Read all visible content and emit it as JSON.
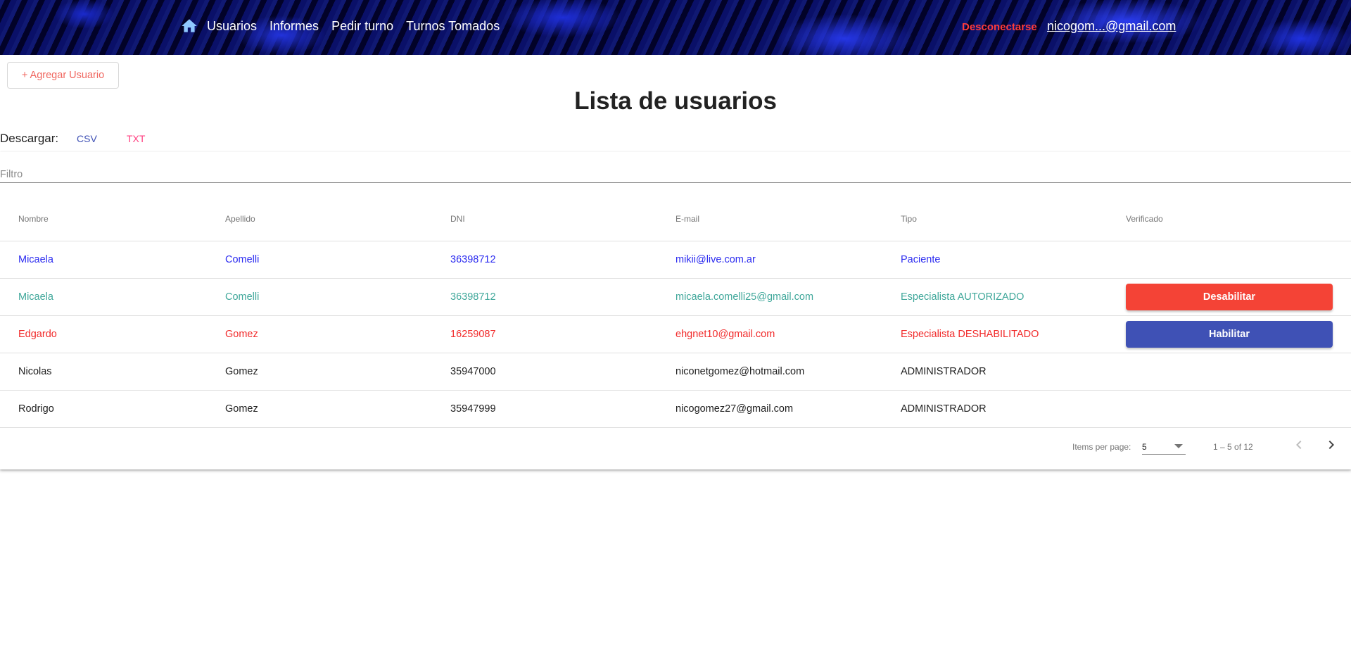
{
  "nav": {
    "items": [
      "Usuarios",
      "Informes",
      "Pedir turno",
      "Turnos Tomados"
    ],
    "logout": "Desconectarse",
    "user_email": "nicogom...@gmail.com"
  },
  "toolbar": {
    "add_user": "+ Agregar Usuario"
  },
  "page": {
    "title": "Lista de usuarios"
  },
  "download": {
    "label": "Descargar:",
    "csv": "CSV",
    "txt": "TXT"
  },
  "filter": {
    "placeholder": "Filtro",
    "value": ""
  },
  "table": {
    "headers": [
      "Nombre",
      "Apellido",
      "DNI",
      "E-mail",
      "Tipo",
      "Verificado"
    ],
    "rows": [
      {
        "nombre": "Micaela",
        "apellido": "Comelli",
        "dni": "36398712",
        "email": "mikii@live.com.ar",
        "tipo": "Paciente",
        "verificado": ""
      },
      {
        "nombre": "Micaela",
        "apellido": "Comelli",
        "dni": "36398712",
        "email": "micaela.comelli25@gmail.com",
        "tipo": "Especialista AUTORIZADO",
        "verificado": "Desabilitar"
      },
      {
        "nombre": "Edgardo",
        "apellido": "Gomez",
        "dni": "16259087",
        "email": "ehgnet10@gmail.com",
        "tipo": "Especialista DESHABILITADO",
        "verificado": "Habilitar"
      },
      {
        "nombre": "Nicolas",
        "apellido": "Gomez",
        "dni": "35947000",
        "email": "niconetgomez@hotmail.com",
        "tipo": "ADMINISTRADOR",
        "verificado": ""
      },
      {
        "nombre": "Rodrigo",
        "apellido": "Gomez",
        "dni": "35947999",
        "email": "nicogomez27@gmail.com",
        "tipo": "ADMINISTRADOR",
        "verificado": ""
      }
    ]
  },
  "paginator": {
    "items_per_page_label": "Items per page:",
    "items_per_page": "5",
    "range": "1 – 5 of 12"
  },
  "colors": {
    "paciente": "#2b2bf0",
    "autorizado": "#3fa79a",
    "deshabilitado": "#f12a2a",
    "disable_button": "#f44336",
    "enable_button": "#3f51b5"
  }
}
